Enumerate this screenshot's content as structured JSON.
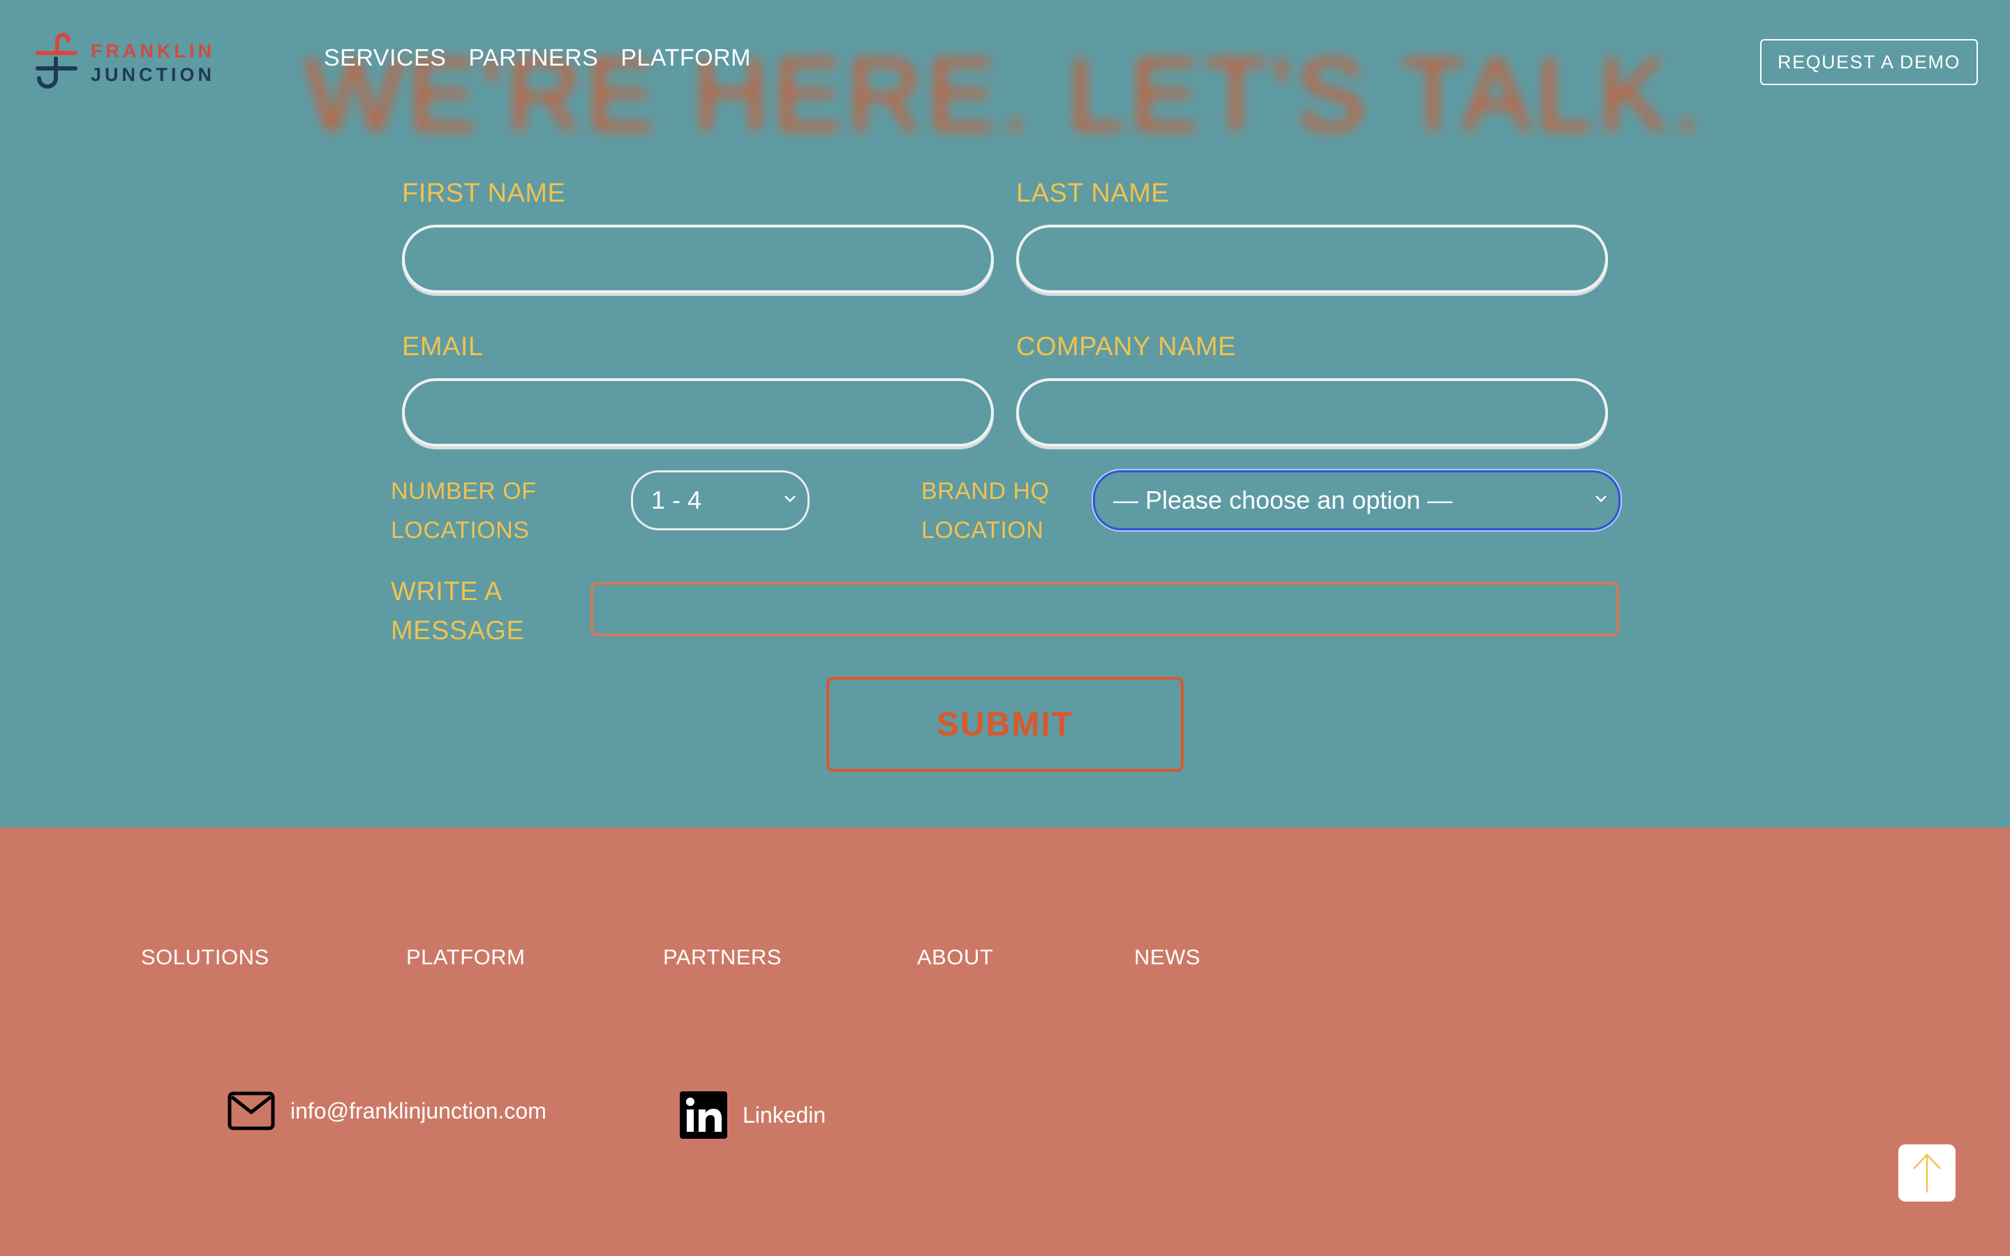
{
  "headline": "WE'RE HERE. LET'S TALK.",
  "brand": {
    "line1": "FRANKLIN",
    "line2": "JUNCTION"
  },
  "nav": [
    "SERVICES",
    "PARTNERS",
    "PLATFORM"
  ],
  "header": {
    "demo_label": "REQUEST A DEMO"
  },
  "form": {
    "first_name_label": "FIRST NAME",
    "last_name_label": "LAST NAME",
    "email_label": "EMAIL",
    "company_label": "COMPANY NAME",
    "locations_label_1": "NUMBER OF",
    "locations_label_2": "LOCATIONS",
    "locations_value": "1 - 4",
    "hq_label_1": "BRAND HQ",
    "hq_label_2": "LOCATION",
    "hq_value": "— Please choose an option —",
    "message_label_1": "WRITE A",
    "message_label_2": "MESSAGE",
    "submit_label": "SUBMIT"
  },
  "footer": {
    "links": [
      "SOLUTIONS",
      "PLATFORM",
      "PARTNERS",
      "ABOUT",
      "NEWS"
    ],
    "email": "info@franklinjunction.com",
    "linkedin": "Linkedin"
  },
  "colors": {
    "teal_bg": "#5e9ba3",
    "salmon_bg": "#cb7966",
    "label_yellow": "#f2c24f",
    "accent_orange": "#d9582b",
    "brand_red": "#d44a3e",
    "brand_navy": "#1e3a52",
    "focus_blue": "#2f55d0"
  },
  "icons": {
    "email": "envelope-icon",
    "linkedin": "linkedin-icon",
    "scroll_top": "arrow-up-icon",
    "select_chevron": "chevron-down-icon"
  }
}
